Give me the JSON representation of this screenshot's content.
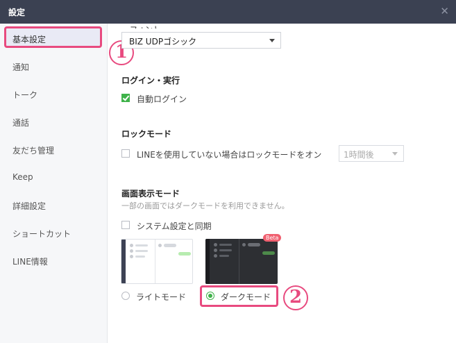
{
  "window": {
    "title": "設定",
    "close_icon": "close-icon"
  },
  "sidebar": {
    "items": [
      {
        "label": "基本設定"
      },
      {
        "label": "通知"
      },
      {
        "label": "トーク"
      },
      {
        "label": "通話"
      },
      {
        "label": "友だち管理"
      },
      {
        "label": "Keep"
      },
      {
        "label": "詳細設定"
      },
      {
        "label": "ショートカット"
      },
      {
        "label": "LINE情報"
      }
    ]
  },
  "font": {
    "label_cutoff": "フォント",
    "selected": "BIZ UDPゴシック"
  },
  "login": {
    "title": "ログイン・実行",
    "auto_login_label": "自動ログイン",
    "auto_login_checked": true
  },
  "lock": {
    "title": "ロックモード",
    "option_label": "LINEを使用していない場合はロックモードをオン",
    "option_checked": false,
    "duration_value": "1時間後"
  },
  "display": {
    "title": "画面表示モード",
    "description": "一部の画面ではダークモードを利用できません。",
    "sync_label": "システム設定と同期",
    "sync_checked": false,
    "light_label": "ライトモード",
    "dark_label": "ダークモード",
    "beta_label": "Beta",
    "selected_mode": "dark"
  },
  "annotations": {
    "step1": "1",
    "step2": "2",
    "accent": "#e84a7f"
  },
  "colors": {
    "titlebar": "#3b4152",
    "check_green": "#3fb24a",
    "sidebar_bg": "#f6f7f9"
  }
}
